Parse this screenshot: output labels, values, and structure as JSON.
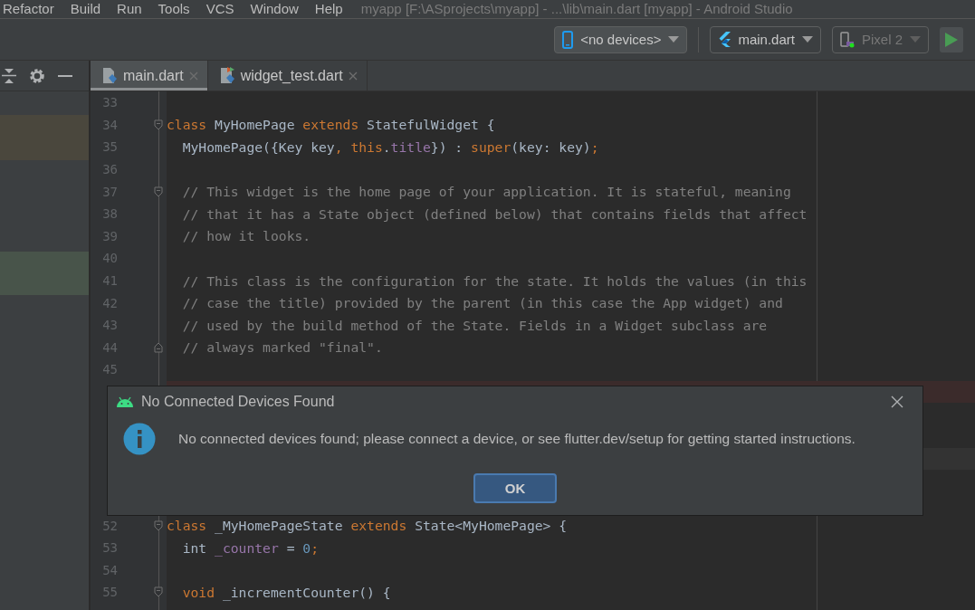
{
  "menu": {
    "items": [
      "Refactor",
      "Build",
      "Run",
      "Tools",
      "VCS",
      "Window",
      "Help"
    ],
    "title": "myapp [F:\\ASprojects\\myapp] - ...\\lib\\main.dart [myapp] - Android Studio"
  },
  "toolbar": {
    "device_selector": {
      "label": "<no devices>"
    },
    "config_selector": {
      "label": "main.dart"
    },
    "target_selector": {
      "label": "Pixel 2",
      "disabled": true
    }
  },
  "left_panel": {
    "highlights": [
      {
        "color": "#4a473d"
      },
      {
        "color": "#48544a"
      }
    ]
  },
  "tabs": [
    {
      "label": "main.dart",
      "selected": true,
      "kind": "dart"
    },
    {
      "label": "widget_test.dart",
      "selected": false,
      "kind": "test"
    }
  ],
  "code_lines": [
    {
      "kind": "plain",
      "number": "33"
    },
    {
      "kind": "fold_start",
      "number": "34",
      "tokens": [
        {
          "kind": "keyword",
          "text": "class"
        },
        {
          "kind": "plain",
          "text": " MyHomePage "
        },
        {
          "kind": "keyword",
          "text": "extends"
        },
        {
          "kind": "plain",
          "text": " StatefulWidget {"
        }
      ]
    },
    {
      "kind": "plain",
      "number": "35",
      "tokens": [
        {
          "kind": "plain",
          "text": "  MyHomePage({Key key"
        },
        {
          "kind": "keyword",
          "text": ", this"
        },
        {
          "kind": "plain",
          "text": "."
        },
        {
          "kind": "field",
          "text": "title"
        },
        {
          "kind": "plain",
          "text": "}) : "
        },
        {
          "kind": "keyword",
          "text": "super"
        },
        {
          "kind": "plain",
          "text": "(key: key)"
        },
        {
          "kind": "keyword",
          "text": ";"
        }
      ]
    },
    {
      "kind": "plain",
      "number": "36"
    },
    {
      "kind": "fold_start",
      "number": "37",
      "tokens": [
        {
          "kind": "comment",
          "text": "  // This widget is the home page of your application. It is stateful, meaning"
        }
      ]
    },
    {
      "kind": "plain",
      "number": "38",
      "tokens": [
        {
          "kind": "comment",
          "text": "  // that it has a State object (defined below) that contains fields that affect"
        }
      ]
    },
    {
      "kind": "plain",
      "number": "39",
      "tokens": [
        {
          "kind": "comment",
          "text": "  // how it looks."
        }
      ]
    },
    {
      "kind": "plain",
      "number": "40"
    },
    {
      "kind": "plain",
      "number": "41",
      "tokens": [
        {
          "kind": "comment",
          "text": "  // This class is the configuration for the state. It holds the values (in this"
        }
      ]
    },
    {
      "kind": "plain",
      "number": "42",
      "tokens": [
        {
          "kind": "comment",
          "text": "  // case the title) provided by the parent (in this case the App widget) and"
        }
      ]
    },
    {
      "kind": "plain",
      "number": "43",
      "tokens": [
        {
          "kind": "comment",
          "text": "  // used by the build method of the State. Fields in a Widget subclass are"
        }
      ]
    },
    {
      "kind": "fold_end",
      "number": "44",
      "tokens": [
        {
          "kind": "comment",
          "text": "  // always marked \"final\"."
        }
      ]
    },
    {
      "kind": "plain",
      "number": "45"
    },
    {
      "kind": "plain",
      "color": "#3b2b2b"
    },
    {
      "kind": "plain"
    },
    {
      "kind": "plain"
    },
    {
      "kind": "plain",
      "color": "#333333"
    },
    {
      "kind": "plain"
    },
    {
      "kind": "plain"
    },
    {
      "kind": "fold_start",
      "number": "52",
      "tokens": [
        {
          "kind": "keyword",
          "text": "class"
        },
        {
          "kind": "plain",
          "text": " _MyHomePageState "
        },
        {
          "kind": "keyword",
          "text": "extends"
        },
        {
          "kind": "plain",
          "text": " State<MyHomePage> {"
        }
      ]
    },
    {
      "kind": "plain",
      "number": "53",
      "tokens": [
        {
          "kind": "plain",
          "text": "  int "
        },
        {
          "kind": "field",
          "text": "_counter"
        },
        {
          "kind": "plain",
          "text": " = "
        },
        {
          "kind": "number",
          "text": "0"
        },
        {
          "kind": "keyword",
          "text": ";"
        }
      ]
    },
    {
      "kind": "plain",
      "number": "54"
    },
    {
      "kind": "fold_start",
      "number": "55",
      "tokens": [
        {
          "kind": "keyword",
          "text": "  void"
        },
        {
          "kind": "plain",
          "text": " _incrementCounter() {"
        }
      ]
    }
  ],
  "dialog": {
    "title": "No Connected Devices Found",
    "message": "No connected devices found; please connect a device, or see flutter.dev/setup for getting started instructions.",
    "button": "OK"
  }
}
